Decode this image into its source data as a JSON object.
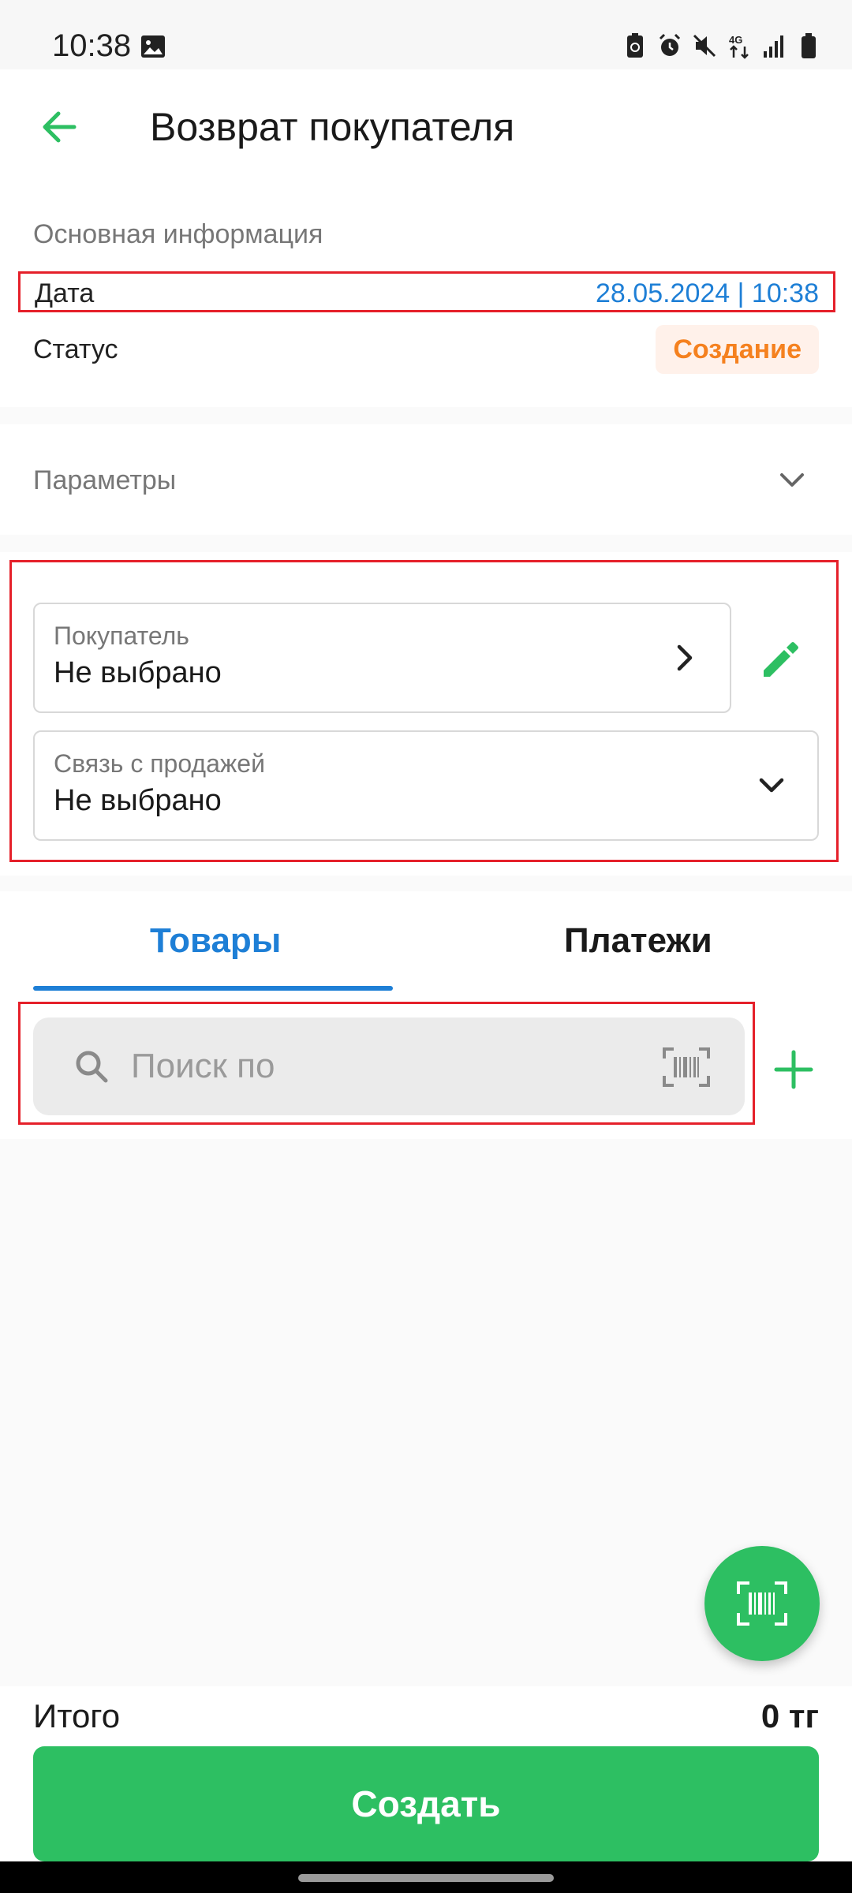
{
  "status_bar": {
    "time": "10:38",
    "icons": [
      "image-icon",
      "battery-saver-icon",
      "alarm-icon",
      "mute-icon",
      "network-4g-icon",
      "signal-icon",
      "battery-icon"
    ]
  },
  "header": {
    "title": "Возврат покупателя",
    "back_icon": "arrow-left-icon"
  },
  "main_info": {
    "section_label": "Основная информация",
    "date_label": "Дата",
    "date_value": "28.05.2024 | 10:38",
    "status_label": "Статус",
    "status_value": "Создание"
  },
  "parameters": {
    "label": "Параметры"
  },
  "customer": {
    "label": "Покупатель",
    "value": "Не выбрано"
  },
  "sale_link": {
    "label": "Связь с продажей",
    "value": "Не выбрано"
  },
  "tabs": [
    {
      "label": "Товары",
      "active": true
    },
    {
      "label": "Платежи",
      "active": false
    }
  ],
  "search": {
    "placeholder": "Поиск по"
  },
  "footer": {
    "total_label": "Итого",
    "total_value": "0 тг",
    "create_label": "Создать"
  },
  "colors": {
    "accent_green": "#2dbf62",
    "accent_blue": "#1e7fd6",
    "status_orange": "#f5811f",
    "highlight_red": "#e5202a"
  }
}
